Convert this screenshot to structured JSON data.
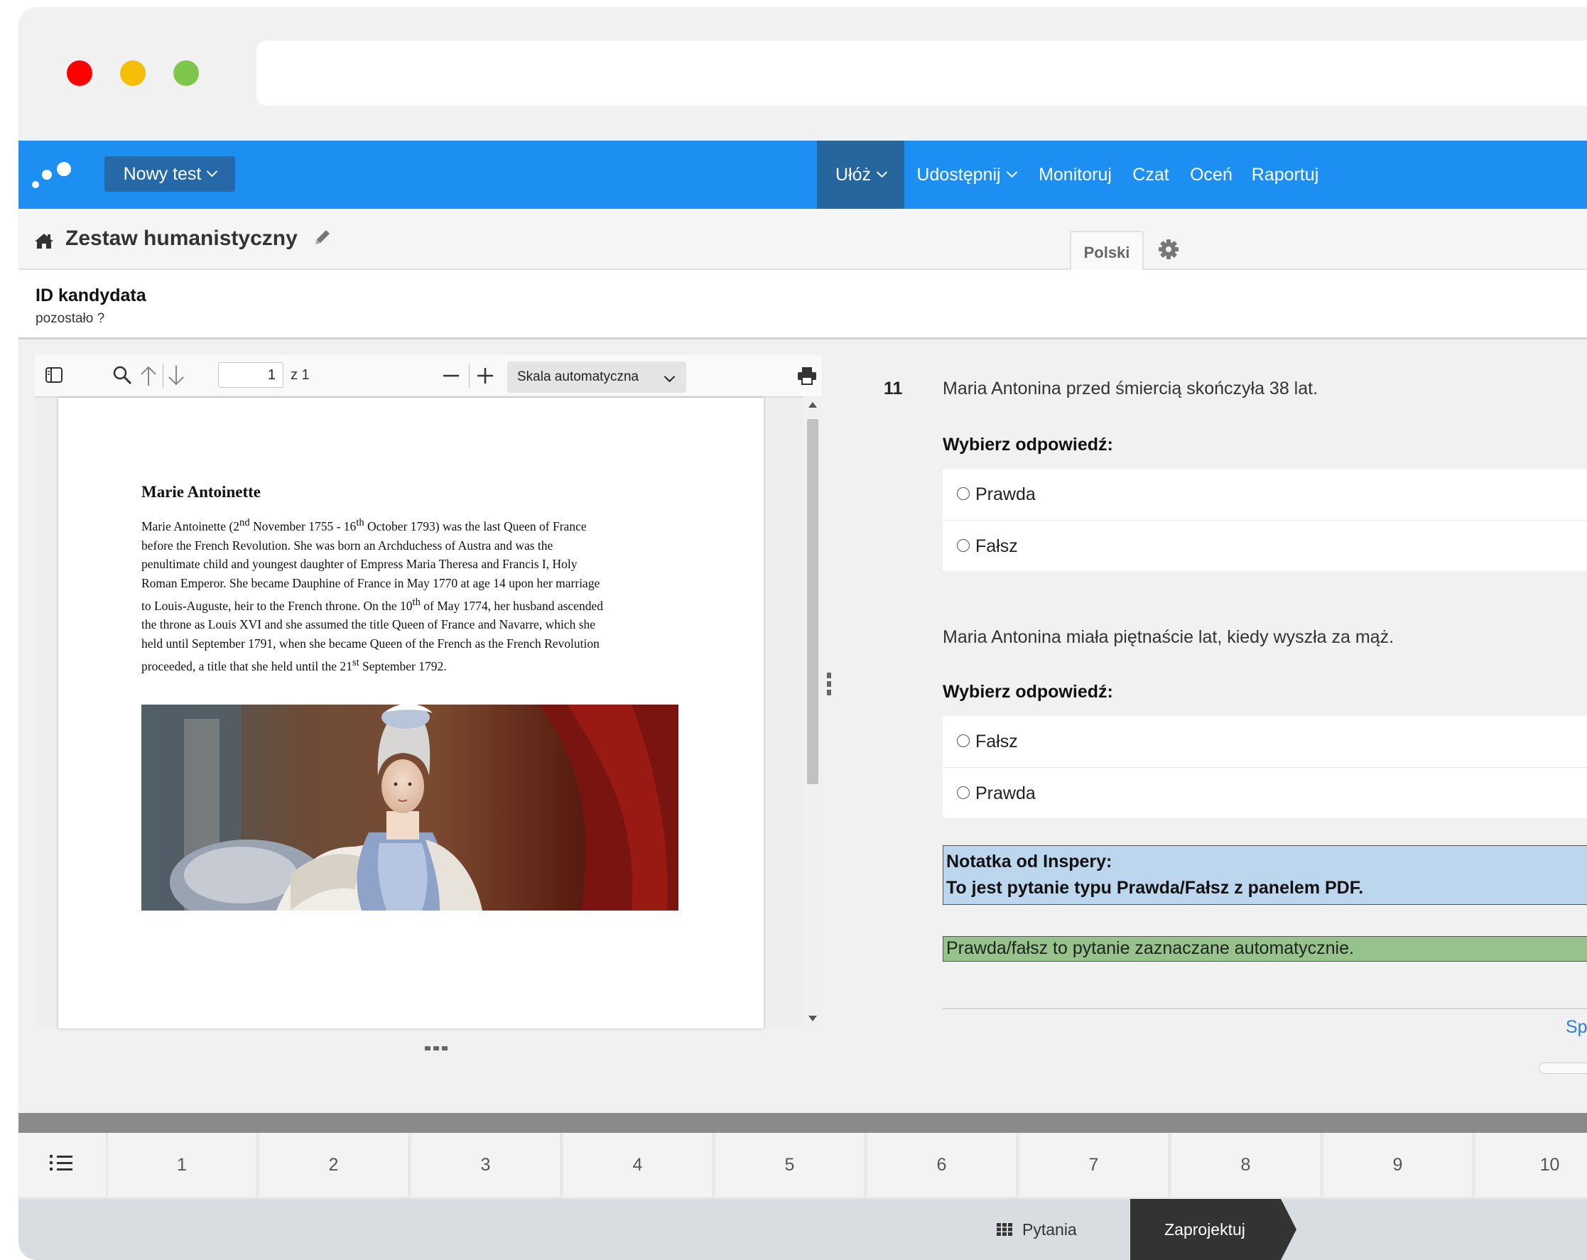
{
  "window": {
    "controls": [
      {
        "name": "close",
        "color": "#ff0000"
      },
      {
        "name": "minimize",
        "color": "#f5be08"
      },
      {
        "name": "maximize",
        "color": "#7fc74c"
      }
    ]
  },
  "colors": {
    "nav_bg": "#1d8ff3",
    "nav_active": "#25669f",
    "new_test_bg": "#2569a8"
  },
  "nav": {
    "new_test_label": "Nowy test",
    "items": [
      {
        "label": "Ułóż",
        "dropdown": true,
        "active": true
      },
      {
        "label": "Udostępnij",
        "dropdown": true,
        "active": false
      },
      {
        "label": "Monitoruj",
        "dropdown": false,
        "active": false
      },
      {
        "label": "Czat",
        "dropdown": false,
        "active": false
      },
      {
        "label": "Oceń",
        "dropdown": false,
        "active": false
      },
      {
        "label": "Raportuj",
        "dropdown": false,
        "active": false
      }
    ]
  },
  "header": {
    "test_name": "Zestaw humanistyczny",
    "language": "Polski",
    "icons": [
      "home-icon",
      "pencil-icon",
      "gear-icon"
    ]
  },
  "candidate": {
    "title": "ID kandydata",
    "remaining": "pozostało ?"
  },
  "pdf": {
    "current_page": "1",
    "page_count": "z 1",
    "scale": "Skala automatyczna",
    "title": "Marie Antoinette",
    "body_html": "Marie Antoinette (2<sup>nd</sup> November 1755 - 16<sup>th</sup> October 1793) was the last Queen of France<br>before the French Revolution. She was born an Archduchess of Austra and was the<br>penultimate child and youngest daughter of Empress Maria Theresa and Francis I, Holy<br>Roman Emperor. She became Dauphine of France in May 1770 at age 14 upon her marriage<br>to Louis-Auguste, heir to the French throne. On the 10<sup>th</sup> of May 1774, her husband ascended<br>the throne as Louis XVI and she assumed the title Queen of France and Navarre, which she<br>held until September 1791, when she became Queen of the French as the French Revolution<br>proceeded, a title that she held until the 21<sup>st</sup> September 1792.",
    "toolbar_icons": [
      "sidebar-toggle-icon",
      "search-icon",
      "arrow-up-icon",
      "arrow-down-icon",
      "zoom-out-icon",
      "zoom-in-icon",
      "print-icon"
    ]
  },
  "question": {
    "number": "11",
    "statements": [
      {
        "text": "Maria Antonina przed śmiercią skończyła 38 lat.",
        "prompt": "Wybierz odpowiedź:",
        "options": [
          "Prawda",
          "Fałsz"
        ]
      },
      {
        "text": "Maria Antonina miała piętnaście lat, kiedy wyszła za mąż.",
        "prompt": "Wybierz odpowiedź:",
        "options": [
          "Fałsz",
          "Prawda"
        ]
      }
    ],
    "note_line1": "Notatka od Inspery:",
    "note_line2": "To jest pytanie typu Prawda/Fałsz z panelem PDF.",
    "info": "Prawda/fałsz to pytanie zaznaczane automatycznie.",
    "next_partial": "Sp"
  },
  "question_nav": {
    "items": [
      "1",
      "2",
      "3",
      "4",
      "5",
      "6",
      "7",
      "8",
      "9",
      "10"
    ]
  },
  "footer": {
    "questions_label": "Pytania",
    "design_label": "Zaprojektuj"
  }
}
